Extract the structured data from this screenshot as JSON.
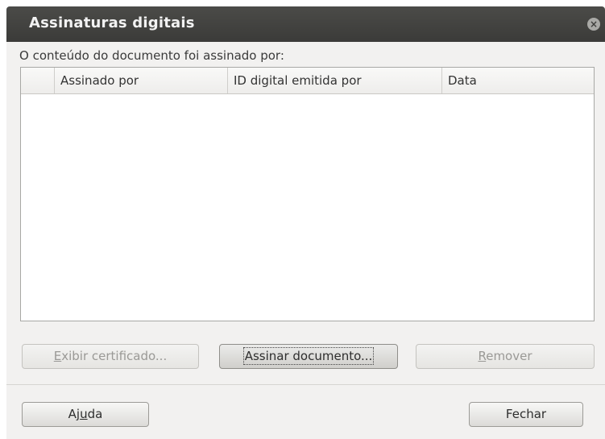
{
  "window": {
    "title": "Assinaturas digitais"
  },
  "dialog": {
    "prompt": "O conteúdo do documento foi assinado por:",
    "table": {
      "columns": [
        "",
        "Assinado por",
        "ID digital emitida por",
        "Data"
      ],
      "rows": []
    },
    "buttons": {
      "view_certificate": {
        "label_pre": "",
        "label_u": "E",
        "label_post": "xibir certificado..."
      },
      "sign_document": {
        "label": "Assinar documento..."
      },
      "remove": {
        "label_pre": "",
        "label_u": "R",
        "label_post": "emover"
      },
      "help": {
        "label_pre": "Aj",
        "label_u": "u",
        "label_post": "da"
      },
      "close": {
        "label": "Fechar"
      }
    }
  }
}
